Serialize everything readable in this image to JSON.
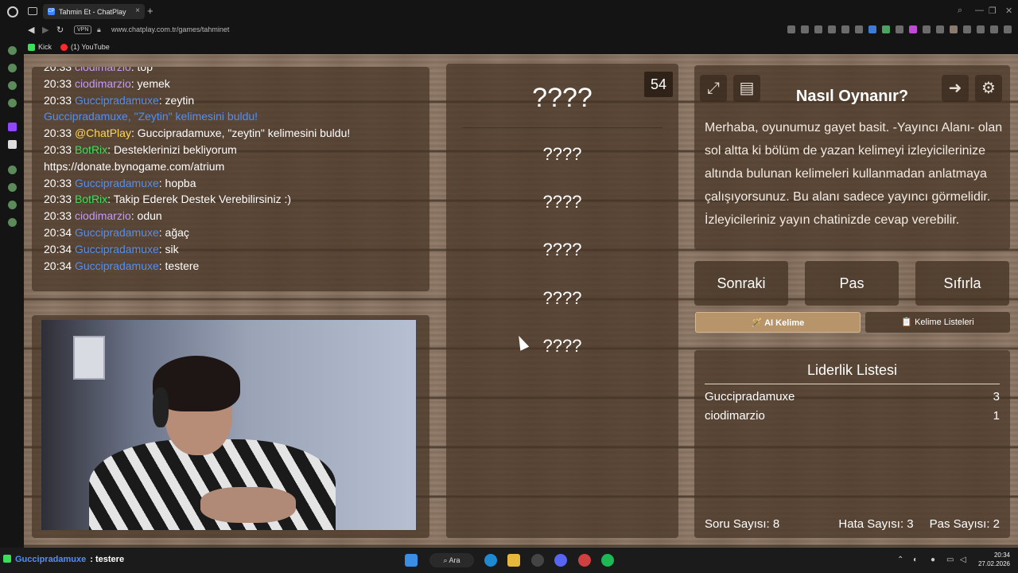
{
  "browser": {
    "tab_title": "Tahmin Et - ChatPlay",
    "tab_favicon": "CP",
    "new_tab": "+",
    "close_tab": "×",
    "vpn_label": "VPN",
    "url": "www.chatplay.com.tr/games/tahminet",
    "bookmarks": [
      {
        "label": "Kick",
        "color": "#39e05a"
      },
      {
        "label": "(1) YouTube",
        "color": "#ff0000"
      }
    ]
  },
  "chat": {
    "lines": [
      {
        "time": "20:33",
        "user": "ciodimarzio",
        "color": "purple",
        "msg": ": top"
      },
      {
        "time": "20:33",
        "user": "ciodimarzio",
        "color": "purple",
        "msg": ": yemek"
      },
      {
        "time": "20:33",
        "user": "Guccipradamuxe",
        "color": "blue",
        "msg": ": zeytin"
      },
      {
        "time": "",
        "user": "Guccipradamuxe, \"Zeytin\" kelimesini buldu!",
        "color": "blue",
        "msg": ""
      },
      {
        "time": "20:33",
        "user": "@ChatPlay",
        "color": "yellow",
        "msg": ": Guccipradamuxe, \"zeytin\" kelimesini buldu!"
      },
      {
        "time": "20:33",
        "user": "BotRix",
        "color": "green",
        "msg": ": Desteklerinizi bekliyorum"
      },
      {
        "time": "",
        "user": "",
        "color": "blue",
        "msg": "https://donate.bynogame.com/atrium"
      },
      {
        "time": "20:33",
        "user": "Guccipradamuxe",
        "color": "blue",
        "msg": ": hopba"
      },
      {
        "time": "20:33",
        "user": "BotRix",
        "color": "green",
        "msg": ": Takip Ederek Destek Verebilirsiniz :)"
      },
      {
        "time": "20:33",
        "user": "ciodimarzio",
        "color": "purple",
        "msg": ": odun"
      },
      {
        "time": "20:34",
        "user": "Guccipradamuxe",
        "color": "blue",
        "msg": ": ağaç"
      },
      {
        "time": "20:34",
        "user": "Guccipradamuxe",
        "color": "blue",
        "msg": ": sik"
      },
      {
        "time": "20:34",
        "user": "Guccipradamuxe",
        "color": "blue",
        "msg": ": testere"
      }
    ]
  },
  "game": {
    "timer": "54",
    "main_word": "????",
    "forbidden_words": [
      "????",
      "????",
      "????",
      "????",
      "????"
    ]
  },
  "howto": {
    "title": "Nasıl Oynanır?",
    "text": "Merhaba, oyunumuz gayet basit. -Yayıncı Alanı- olan sol altta ki bölüm de yazan kelimeyi izleyicilerinize altında bulunan kelimeleri kullanmadan anlatmaya çalışıyorsunuz. Bu alanı sadece yayıncı görmelidir. İzleyicileriniz yayın chatinizde cevap verebilir."
  },
  "actions": {
    "next": "Sonraki",
    "pass": "Pas",
    "reset": "Sıfırla",
    "ai_word": "🪄 AI Kelime",
    "word_lists": "📋 Kelime Listeleri"
  },
  "leaderboard": {
    "title": "Liderlik Listesi",
    "rows": [
      {
        "name": "Guccipradamuxe",
        "score": "3"
      },
      {
        "name": "ciodimarzio",
        "score": "1"
      }
    ],
    "question_count": "Soru Sayısı: 8",
    "error_count": "Hata Sayısı: 3",
    "pass_count": "Pas Sayısı: 2"
  },
  "taskbar": {
    "chat_user": "Guccipradamuxe",
    "chat_msg": ": testere",
    "search": "Ara",
    "time": "20:34",
    "date": "27.02.2026"
  },
  "colors": {
    "purple": "#c39bf0",
    "blue": "#4f8ff7",
    "green": "#39e05a",
    "yellow": "#ffd84a"
  }
}
